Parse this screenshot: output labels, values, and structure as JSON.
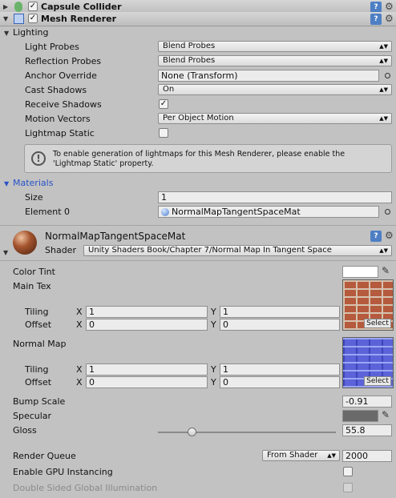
{
  "capsule_collider": {
    "title": "Capsule Collider",
    "icon": "capsule-collider-icon"
  },
  "mesh_renderer": {
    "title": "Mesh Renderer",
    "lighting_section": "Lighting",
    "light_probes_label": "Light Probes",
    "light_probes_value": "Blend Probes",
    "reflection_probes_label": "Reflection Probes",
    "reflection_probes_value": "Blend Probes",
    "anchor_override_label": "Anchor Override",
    "anchor_override_value": "None (Transform)",
    "cast_shadows_label": "Cast Shadows",
    "cast_shadows_value": "On",
    "receive_shadows_label": "Receive Shadows",
    "receive_shadows_checked": true,
    "motion_vectors_label": "Motion Vectors",
    "motion_vectors_value": "Per Object Motion",
    "lightmap_static_label": "Lightmap Static",
    "lightmap_static_checked": false,
    "info_line1": "To enable generation of lightmaps for this Mesh Renderer, please enable the",
    "info_line2": "'Lightmap Static' property.",
    "materials_section": "Materials",
    "size_label": "Size",
    "size_value": "1",
    "element0_label": "Element 0",
    "element0_value": "NormalMapTangentSpaceMat"
  },
  "material": {
    "name": "NormalMapTangentSpaceMat",
    "shader_label": "Shader",
    "shader_value": "Unity Shaders Book/Chapter 7/Normal Map In Tangent Space",
    "color_tint_label": "Color Tint",
    "color_tint_value": "#ffffff",
    "main_tex_label": "Main Tex",
    "normal_map_label": "Normal Map",
    "tiling_label": "Tiling",
    "offset_label": "Offset",
    "x_label": "X",
    "y_label": "Y",
    "main_tiling_x": "1",
    "main_tiling_y": "1",
    "main_offset_x": "0",
    "main_offset_y": "0",
    "normal_tiling_x": "1",
    "normal_tiling_y": "1",
    "normal_offset_x": "0",
    "normal_offset_y": "0",
    "select_label": "Select",
    "bump_scale_label": "Bump Scale",
    "bump_scale_value": "-0.91",
    "specular_label": "Specular",
    "specular_value": "#6a6a6a",
    "gloss_label": "Gloss",
    "gloss_value": "55.8",
    "gloss_min": 8,
    "gloss_max": 256,
    "render_queue_label": "Render Queue",
    "render_queue_mode": "From Shader",
    "render_queue_value": "2000",
    "gpu_instancing_label": "Enable GPU Instancing",
    "double_sided_gi_label": "Double Sided Global Illumination"
  }
}
